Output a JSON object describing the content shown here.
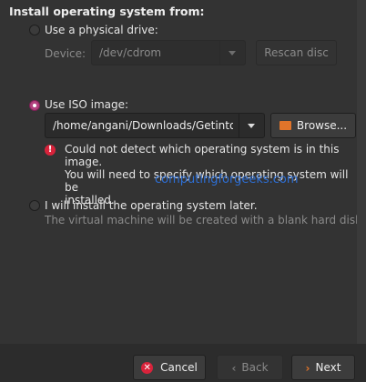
{
  "title": "Install operating system from:",
  "physical": {
    "label": "Use a physical drive:",
    "device_label": "Device:",
    "device_value": "/dev/cdrom",
    "rescan": "Rescan disc"
  },
  "iso": {
    "label": "Use ISO image:",
    "path": "/home/angani/Downloads/Getintop",
    "browse": "Browse...",
    "error_lines": [
      "Could not detect which operating system is in this image.",
      "You will need to specify which operating system will be",
      "installed."
    ]
  },
  "later": {
    "label": "I will install the operating system later.",
    "sublabel": "The virtual machine will be created with a blank hard disk."
  },
  "watermark": "computingforgeeks.com",
  "footer": {
    "cancel": "Cancel",
    "back": "Back",
    "next": "Next"
  },
  "colors": {
    "accent": "#b3407f",
    "error": "#d8233b",
    "next_icon": "#e0742a"
  }
}
